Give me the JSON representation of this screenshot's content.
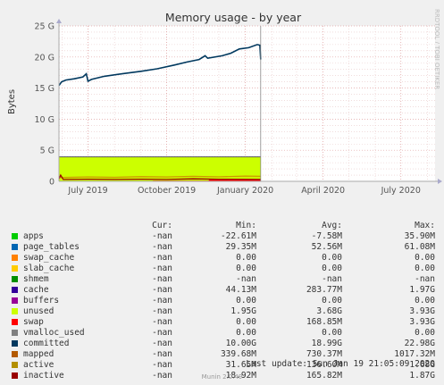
{
  "chart_data": {
    "type": "area",
    "title": "Memory usage - by year",
    "ylabel": "Bytes",
    "side_label": "RRDTOOL / TOBI OETIKER",
    "ylim": [
      0,
      25
    ],
    "yunit": "G",
    "yticks": [
      {
        "value": 0,
        "label": "0"
      },
      {
        "value": 5,
        "label": "5 G"
      },
      {
        "value": 10,
        "label": "10 G"
      },
      {
        "value": 15,
        "label": "15 G"
      },
      {
        "value": 20,
        "label": "20 G"
      },
      {
        "value": 25,
        "label": "25 G"
      }
    ],
    "xlim": [
      "2019-05-28",
      "2020-08-10"
    ],
    "xticks": [
      {
        "date": "2019-07-01",
        "label": "July 2019"
      },
      {
        "date": "2019-10-01",
        "label": "October 2019"
      },
      {
        "date": "2020-01-01",
        "label": "January 2020"
      },
      {
        "date": "2020-04-01",
        "label": "April 2020"
      },
      {
        "date": "2020-07-01",
        "label": "July 2020"
      }
    ],
    "data_end": "2020-01-19",
    "grid": true,
    "series": [
      {
        "name": "unused",
        "color": "#ccff00",
        "fill": true,
        "points": [
          [
            "2019-05-28",
            3.93
          ],
          [
            "2020-01-19",
            3.93
          ]
        ]
      },
      {
        "name": "swap",
        "color": "#ff0000",
        "fill": true,
        "points": [
          [
            "2019-05-28",
            0
          ],
          [
            "2019-09-14",
            0
          ],
          [
            "2019-09-15",
            0.1
          ],
          [
            "2019-11-19",
            0.12
          ],
          [
            "2019-11-20",
            0.3
          ],
          [
            "2020-01-19",
            0.33
          ]
        ]
      },
      {
        "name": "active",
        "color": "#cc9900",
        "fill": false,
        "points": [
          [
            "2019-05-28",
            0.6
          ],
          [
            "2019-07-01",
            0.7
          ],
          [
            "2019-08-01",
            0.65
          ],
          [
            "2019-09-01",
            0.75
          ],
          [
            "2019-10-01",
            0.7
          ],
          [
            "2019-11-01",
            0.8
          ],
          [
            "2019-12-01",
            0.72
          ],
          [
            "2020-01-01",
            0.85
          ],
          [
            "2020-01-19",
            0.8
          ]
        ]
      },
      {
        "name": "inactive",
        "color": "#990000",
        "fill": false,
        "points": [
          [
            "2019-05-28",
            0.4
          ],
          [
            "2019-05-30",
            1.0
          ],
          [
            "2019-06-02",
            0.3
          ],
          [
            "2019-07-01",
            0.35
          ],
          [
            "2019-08-01",
            0.3
          ],
          [
            "2019-09-01",
            0.35
          ],
          [
            "2019-10-01",
            0.3
          ],
          [
            "2019-11-01",
            0.4
          ],
          [
            "2019-12-01",
            0.35
          ],
          [
            "2020-01-19",
            0.3
          ]
        ]
      },
      {
        "name": "committed",
        "color": "#00385e",
        "fill": false,
        "points": [
          [
            "2019-05-28",
            15.4
          ],
          [
            "2019-05-31",
            16.0
          ],
          [
            "2019-06-05",
            16.3
          ],
          [
            "2019-06-15",
            16.5
          ],
          [
            "2019-06-25",
            16.8
          ],
          [
            "2019-06-29",
            17.3
          ],
          [
            "2019-07-01",
            16.1
          ],
          [
            "2019-07-05",
            16.4
          ],
          [
            "2019-07-20",
            16.9
          ],
          [
            "2019-08-10",
            17.3
          ],
          [
            "2019-09-01",
            17.7
          ],
          [
            "2019-09-20",
            18.1
          ],
          [
            "2019-10-10",
            18.7
          ],
          [
            "2019-10-25",
            19.2
          ],
          [
            "2019-11-08",
            19.6
          ],
          [
            "2019-11-15",
            20.2
          ],
          [
            "2019-11-18",
            19.8
          ],
          [
            "2019-12-05",
            20.2
          ],
          [
            "2019-12-15",
            20.6
          ],
          [
            "2019-12-25",
            21.3
          ],
          [
            "2020-01-05",
            21.5
          ],
          [
            "2020-01-15",
            22.0
          ],
          [
            "2020-01-18",
            21.9
          ],
          [
            "2020-01-19",
            19.6
          ]
        ]
      }
    ]
  },
  "legend": {
    "headers": {
      "cur": "Cur:",
      "min": "Min:",
      "avg": "Avg:",
      "max": "Max:"
    },
    "rows": [
      {
        "name": "apps",
        "color": "#00cc00",
        "cur": "-nan",
        "min": "-22.61M",
        "avg": "-7.58M",
        "max": "35.90M"
      },
      {
        "name": "page_tables",
        "color": "#0066b3",
        "cur": "-nan",
        "min": "29.35M",
        "avg": "52.56M",
        "max": "61.08M"
      },
      {
        "name": "swap_cache",
        "color": "#ff8000",
        "cur": "-nan",
        "min": "0.00",
        "avg": "0.00",
        "max": "0.00"
      },
      {
        "name": "slab_cache",
        "color": "#ffcc00",
        "cur": "-nan",
        "min": "0.00",
        "avg": "0.00",
        "max": "0.00"
      },
      {
        "name": "shmem",
        "color": "#008f00",
        "cur": "-nan",
        "min": "-nan",
        "avg": "-nan",
        "max": "-nan"
      },
      {
        "name": "cache",
        "color": "#330099",
        "cur": "-nan",
        "min": "44.13M",
        "avg": "283.77M",
        "max": "1.97G"
      },
      {
        "name": "buffers",
        "color": "#990099",
        "cur": "-nan",
        "min": "0.00",
        "avg": "0.00",
        "max": "0.00"
      },
      {
        "name": "unused",
        "color": "#ccff00",
        "cur": "-nan",
        "min": "1.95G",
        "avg": "3.68G",
        "max": "3.93G"
      },
      {
        "name": "swap",
        "color": "#ff0000",
        "cur": "-nan",
        "min": "0.00",
        "avg": "168.85M",
        "max": "3.93G"
      },
      {
        "name": "vmalloc_used",
        "color": "#808080",
        "cur": "-nan",
        "min": "0.00",
        "avg": "0.00",
        "max": "0.00"
      },
      {
        "name": "committed",
        "color": "#00385e",
        "cur": "-nan",
        "min": "10.00G",
        "avg": "18.99G",
        "max": "22.98G"
      },
      {
        "name": "mapped",
        "color": "#b35a00",
        "cur": "-nan",
        "min": "339.68M",
        "avg": "730.37M",
        "max": "1017.32M"
      },
      {
        "name": "active",
        "color": "#b38f00",
        "cur": "-nan",
        "min": "31.65M",
        "avg": "136.60M",
        "max": "1.68G"
      },
      {
        "name": "inactive",
        "color": "#990000",
        "cur": "-nan",
        "min": "18.92M",
        "avg": "165.82M",
        "max": "1.87G"
      }
    ]
  },
  "last_update": "Last update: Sun Jan 19 21:05:09 2020",
  "footer": "Munin 2.0.49"
}
